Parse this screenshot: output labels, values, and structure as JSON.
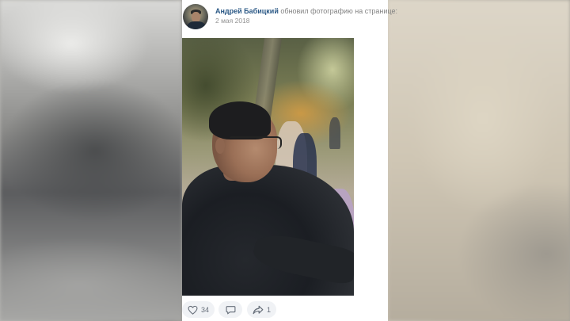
{
  "post": {
    "author_name": "Андрей Бабицкий",
    "action_text": "обновил фотографию на странице:",
    "date": "2 мая 2018"
  },
  "actions": {
    "likes_count": "34",
    "comments_count": "",
    "shares_count": "1"
  },
  "colors": {
    "author_link": "#2a5885",
    "secondary_text": "#828282",
    "action_pill_bg": "#f0f2f5",
    "action_icon": "#656d78"
  },
  "icons": {
    "like": "heart-icon",
    "comment": "comment-icon",
    "share": "share-arrow-icon"
  }
}
